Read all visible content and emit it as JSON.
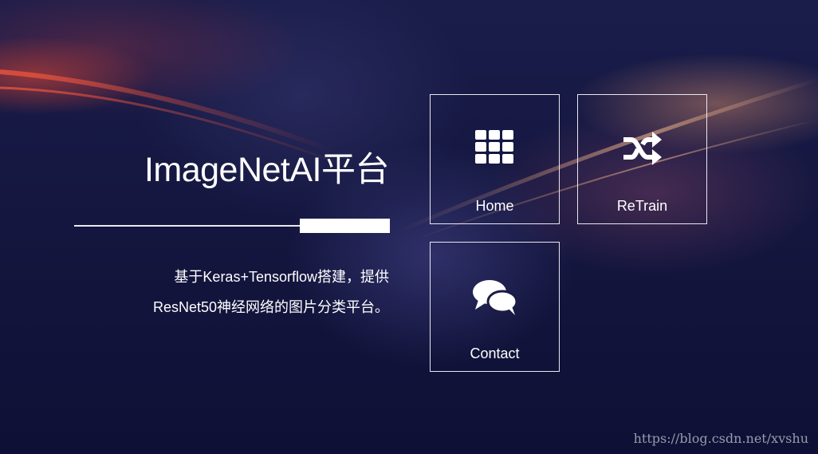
{
  "hero": {
    "title": "ImageNetAI平台",
    "description_line1": "基于Keras+Tensorflow搭建，提供",
    "description_line2": "ResNet50神经网络的图片分类平台。"
  },
  "tiles": [
    {
      "label": "Home",
      "icon": "grid-icon"
    },
    {
      "label": "ReTrain",
      "icon": "shuffle-icon"
    },
    {
      "label": "Contact",
      "icon": "chat-bubbles-icon"
    }
  ],
  "watermark": "https://blog.csdn.net/xvshu",
  "colors": {
    "background": "#12143a",
    "text": "#ffffff",
    "border": "#e8e8f0"
  }
}
